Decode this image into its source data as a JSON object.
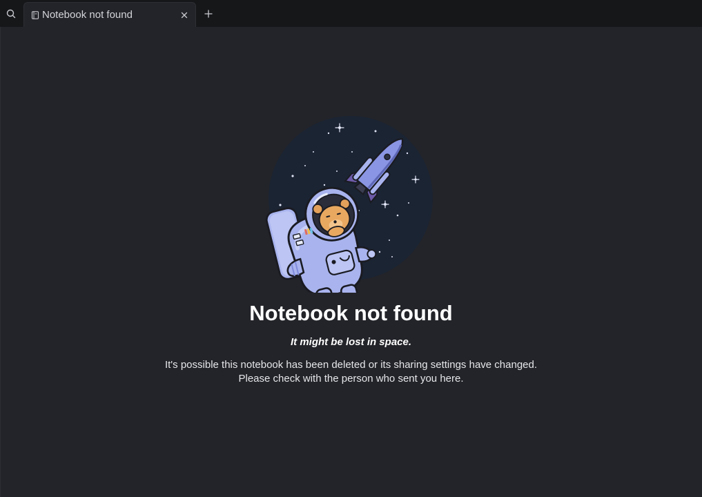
{
  "tab": {
    "label": "Notebook not found",
    "icon": "notebook-icon"
  },
  "toolbar": {
    "search_icon": "search-icon",
    "close_icon": "close-icon",
    "new_tab_icon": "plus-icon"
  },
  "main": {
    "title": "Notebook not found",
    "subtitle": "It might be lost in space.",
    "description_line1": "It's possible this notebook has been deleted or its sharing settings have changed.",
    "description_line2": "Please check with the person who sent you here."
  },
  "colors": {
    "background": "#232429",
    "tabbar": "#161719",
    "illustration_circle": "#1b2433",
    "astronaut_suit": "#a9b4ee",
    "rocket": "#7f8bdc"
  }
}
